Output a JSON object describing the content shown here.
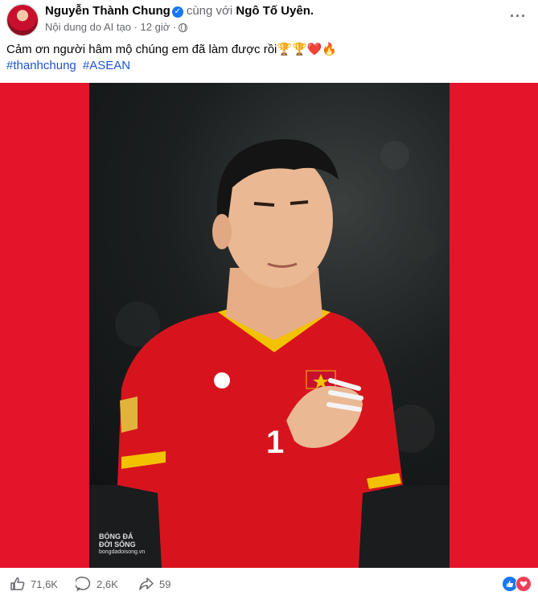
{
  "post": {
    "author": "Nguyễn Thành Chung",
    "with_text": "cùng với",
    "tagged": "Ngô Tố Uyên.",
    "meta": "Nội dung do AI tạo · 12 giờ ·",
    "caption": "Cảm ơn người hâm mộ chúng em đã làm được rồi🏆🏆❤️🔥",
    "hashtags": [
      "#thanhchung",
      "#ASEAN"
    ],
    "more_icon": "more-options-icon"
  },
  "image": {
    "watermark_line1": "BÓNG ĐÁ",
    "watermark_line2": "ĐỜI SỐNG",
    "watermark_line3": "bongdadoisong.vn"
  },
  "stats": {
    "likes": "71,6K",
    "comments": "2,6K",
    "shares": "59"
  },
  "colors": {
    "accent": "#1877f2",
    "banner_red": "#e4142b",
    "jersey_red": "#d7141e"
  }
}
